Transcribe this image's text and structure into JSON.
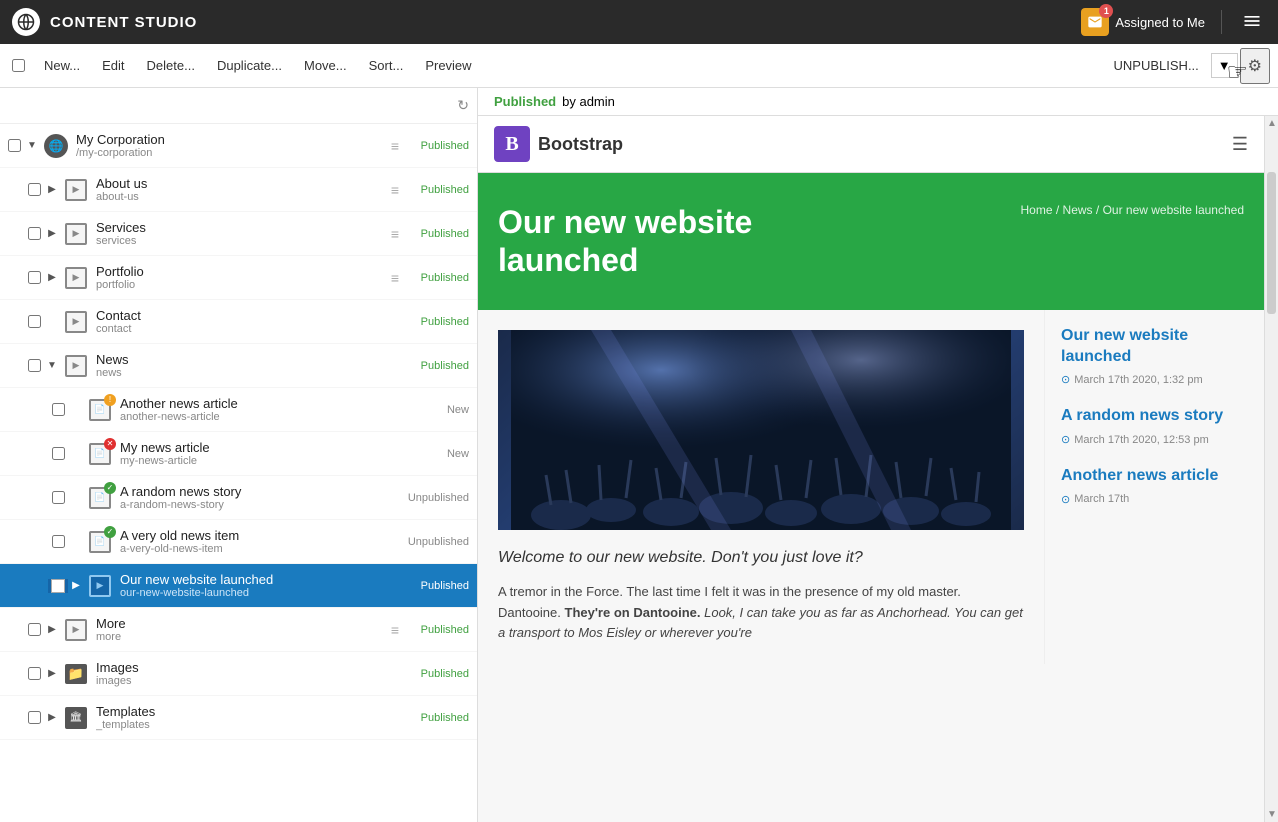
{
  "topbar": {
    "logo_alt": "Content Studio Logo",
    "title": "CONTENT STUDIO",
    "assigned_label": "Assigned to Me",
    "assigned_count": "1"
  },
  "toolbar": {
    "new_label": "New...",
    "edit_label": "Edit",
    "delete_label": "Delete...",
    "duplicate_label": "Duplicate...",
    "move_label": "Move...",
    "sort_label": "Sort...",
    "preview_label": "Preview",
    "unpublish_label": "UNPUBLISH...",
    "settings_icon": "⚙"
  },
  "sidebar": {
    "items": [
      {
        "id": "my-corporation",
        "name": "My Corporation",
        "path": "/my-corporation",
        "status": "Published",
        "indent": 0,
        "type": "globe",
        "expanded": true,
        "has_checkbox": true
      },
      {
        "id": "about-us",
        "name": "About us",
        "path": "about-us",
        "status": "Published",
        "indent": 1,
        "type": "page",
        "expanded": false,
        "has_drag": true,
        "has_checkbox": true
      },
      {
        "id": "services",
        "name": "Services",
        "path": "services",
        "status": "Published",
        "indent": 1,
        "type": "page",
        "expanded": false,
        "has_drag": true,
        "has_checkbox": true
      },
      {
        "id": "portfolio",
        "name": "Portfolio",
        "path": "portfolio",
        "status": "Published",
        "indent": 1,
        "type": "page",
        "expanded": false,
        "has_drag": true,
        "has_checkbox": true
      },
      {
        "id": "contact",
        "name": "Contact",
        "path": "contact",
        "status": "Published",
        "indent": 1,
        "type": "page",
        "expanded": false,
        "has_checkbox": true
      },
      {
        "id": "news",
        "name": "News",
        "path": "news",
        "status": "Published",
        "indent": 1,
        "type": "page",
        "expanded": true,
        "has_checkbox": true
      },
      {
        "id": "another-news-article",
        "name": "Another news article",
        "path": "another-news-article",
        "status": "New",
        "indent": 2,
        "type": "news-warning",
        "has_checkbox": true
      },
      {
        "id": "my-news-article",
        "name": "My news article",
        "path": "my-news-article",
        "status": "New",
        "indent": 2,
        "type": "news-error",
        "has_checkbox": true
      },
      {
        "id": "a-random-news-story",
        "name": "A random news story",
        "path": "a-random-news-story",
        "status": "Unpublished",
        "indent": 2,
        "type": "news-ok",
        "has_checkbox": true
      },
      {
        "id": "a-very-old-news-item",
        "name": "A very old news item",
        "path": "a-very-old-news-item",
        "status": "Unpublished",
        "indent": 2,
        "type": "news-ok",
        "has_checkbox": true
      },
      {
        "id": "our-new-website-launched",
        "name": "Our new website launched",
        "path": "our-new-website-launched",
        "status": "Published",
        "indent": 2,
        "type": "news-blue",
        "selected": true,
        "expanded": false,
        "has_checkbox": true,
        "has_expand": true
      },
      {
        "id": "more",
        "name": "More",
        "path": "more",
        "status": "Published",
        "indent": 1,
        "type": "page",
        "expanded": false,
        "has_drag": true,
        "has_checkbox": true,
        "has_expand": true
      },
      {
        "id": "images",
        "name": "Images",
        "path": "images",
        "status": "Published",
        "indent": 1,
        "type": "folder",
        "expanded": false,
        "has_checkbox": true,
        "has_expand": true
      },
      {
        "id": "templates",
        "name": "Templates",
        "path": "_templates",
        "status": "Published",
        "indent": 1,
        "type": "templates",
        "expanded": false,
        "has_checkbox": true,
        "has_expand": true
      }
    ]
  },
  "content": {
    "status": "Published",
    "published_by": "by admin",
    "preview": {
      "nav_brand": "Bootstrap",
      "hero_title": "Our new website launched",
      "breadcrumb": {
        "home": "Home",
        "sep1": "/",
        "news": "News",
        "sep2": "/",
        "page": "Our new website launched"
      },
      "quote": "Welcome to our new website. Don't you just love it?",
      "body_text": "A tremor in the Force. The last time I felt it was in the presence of my old master. Dantooine. They're on Dantooine. Look, I can take you as far as Anchorhead. You can get a transport to Mos Eisley or wherever you're",
      "sidebar_articles": [
        {
          "title": "Our new website launched",
          "date": "March 17th 2020, 1:32 pm"
        },
        {
          "title": "A random news story",
          "date": "March 17th 2020, 12:53 pm"
        },
        {
          "title": "Another news article",
          "date": "March 17th"
        }
      ]
    }
  }
}
